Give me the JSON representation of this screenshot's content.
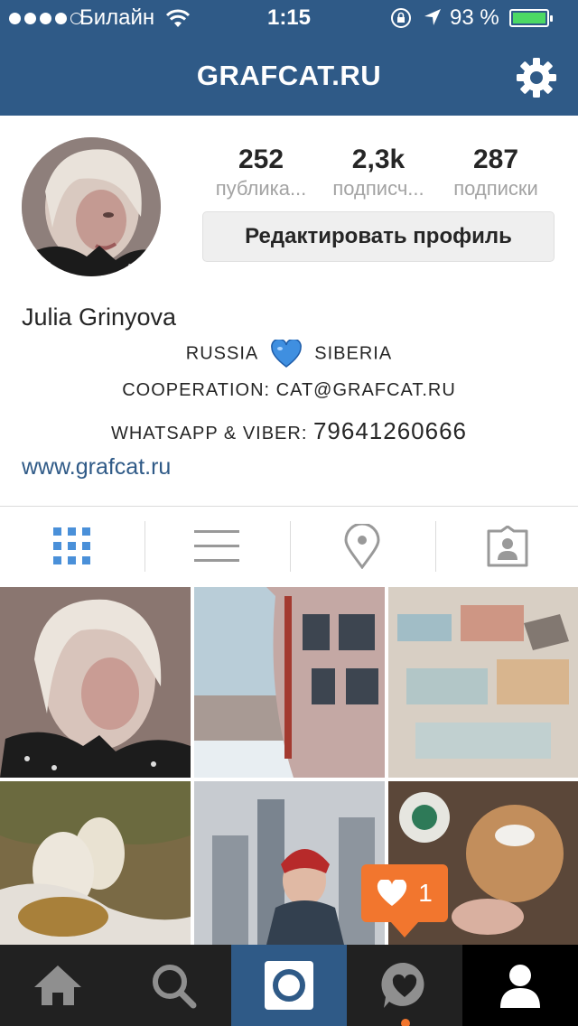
{
  "status_bar": {
    "carrier": "Билайн",
    "time": "1:15",
    "battery_percent": "93 %",
    "battery_level": 0.93,
    "signal_bars_filled": 4,
    "signal_bars_total": 5
  },
  "nav": {
    "title": "GRAFCAT.RU",
    "settings_icon": "gear-icon"
  },
  "profile": {
    "stats": [
      {
        "value": "252",
        "label": "публика..."
      },
      {
        "value": "2,3k",
        "label": "подписч..."
      },
      {
        "value": "287",
        "label": "подписки"
      }
    ],
    "edit_button": "Редактировать профиль",
    "name": "Julia Grinyova",
    "bio_line1_left": "RUSSIA",
    "bio_line1_emoji": "blue-heart-icon",
    "bio_line1_right": "SIBERIA",
    "bio_line2": "COOPERATION: CAT@GRAFCAT.RU",
    "bio_line3_label": "WHATSAPP & VIBER:",
    "bio_line3_number": "79641260666",
    "website": "www.grafcat.ru"
  },
  "view_tabs": [
    {
      "name": "grid-view-tab",
      "icon": "grid-icon",
      "active": true
    },
    {
      "name": "list-view-tab",
      "icon": "list-icon",
      "active": false
    },
    {
      "name": "map-view-tab",
      "icon": "location-pin-icon",
      "active": false
    },
    {
      "name": "tagged-view-tab",
      "icon": "tagged-photos-icon",
      "active": false
    }
  ],
  "notification": {
    "icon": "heart-icon",
    "count": "1"
  },
  "tab_bar": [
    {
      "name": "home-tab",
      "icon": "home-icon"
    },
    {
      "name": "search-tab",
      "icon": "search-icon"
    },
    {
      "name": "camera-tab",
      "icon": "camera-icon"
    },
    {
      "name": "activity-tab",
      "icon": "activity-heart-icon"
    },
    {
      "name": "profile-tab",
      "icon": "profile-icon",
      "active": true
    }
  ],
  "colors": {
    "accent": "#2f5a87",
    "notification": "#f2762e",
    "tab_bar": "#212121",
    "active_tab_icon": "#4a90d9"
  }
}
